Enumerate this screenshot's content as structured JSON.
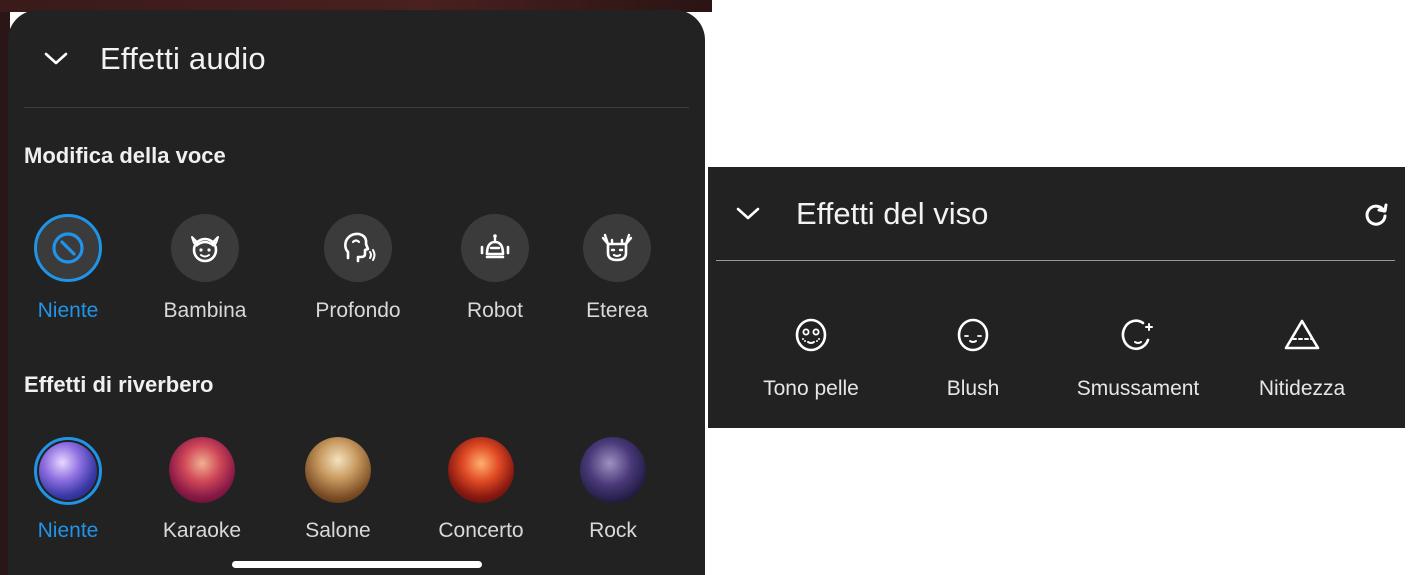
{
  "audio": {
    "title": "Effetti audio",
    "voice_section": "Modifica della voce",
    "voice_items": [
      {
        "label": "Niente",
        "icon": "none-icon",
        "selected": true
      },
      {
        "label": "Bambina",
        "icon": "girl-face-icon",
        "selected": false
      },
      {
        "label": "Profondo",
        "icon": "deep-voice-icon",
        "selected": false
      },
      {
        "label": "Robot",
        "icon": "robot-icon",
        "selected": false
      },
      {
        "label": "Eterea",
        "icon": "ethereal-icon",
        "selected": false
      }
    ],
    "reverb_section": "Effetti di riverbero",
    "reverb_items": [
      {
        "label": "Niente",
        "selected": true
      },
      {
        "label": "Karaoke",
        "selected": false
      },
      {
        "label": "Salone",
        "selected": false
      },
      {
        "label": "Concerto",
        "selected": false
      },
      {
        "label": "Rock",
        "selected": false
      }
    ]
  },
  "face": {
    "title": "Effetti del viso",
    "items": [
      {
        "label": "Tono pelle",
        "icon": "skin-tone-icon"
      },
      {
        "label": "Blush",
        "icon": "blush-icon"
      },
      {
        "label": "Smussament",
        "icon": "smoothing-icon"
      },
      {
        "label": "Nitidezza",
        "icon": "sharpness-icon"
      }
    ]
  },
  "colors": {
    "panel_bg": "#222222",
    "accent": "#1f94e8",
    "icon_bg": "#3b3b3b"
  }
}
